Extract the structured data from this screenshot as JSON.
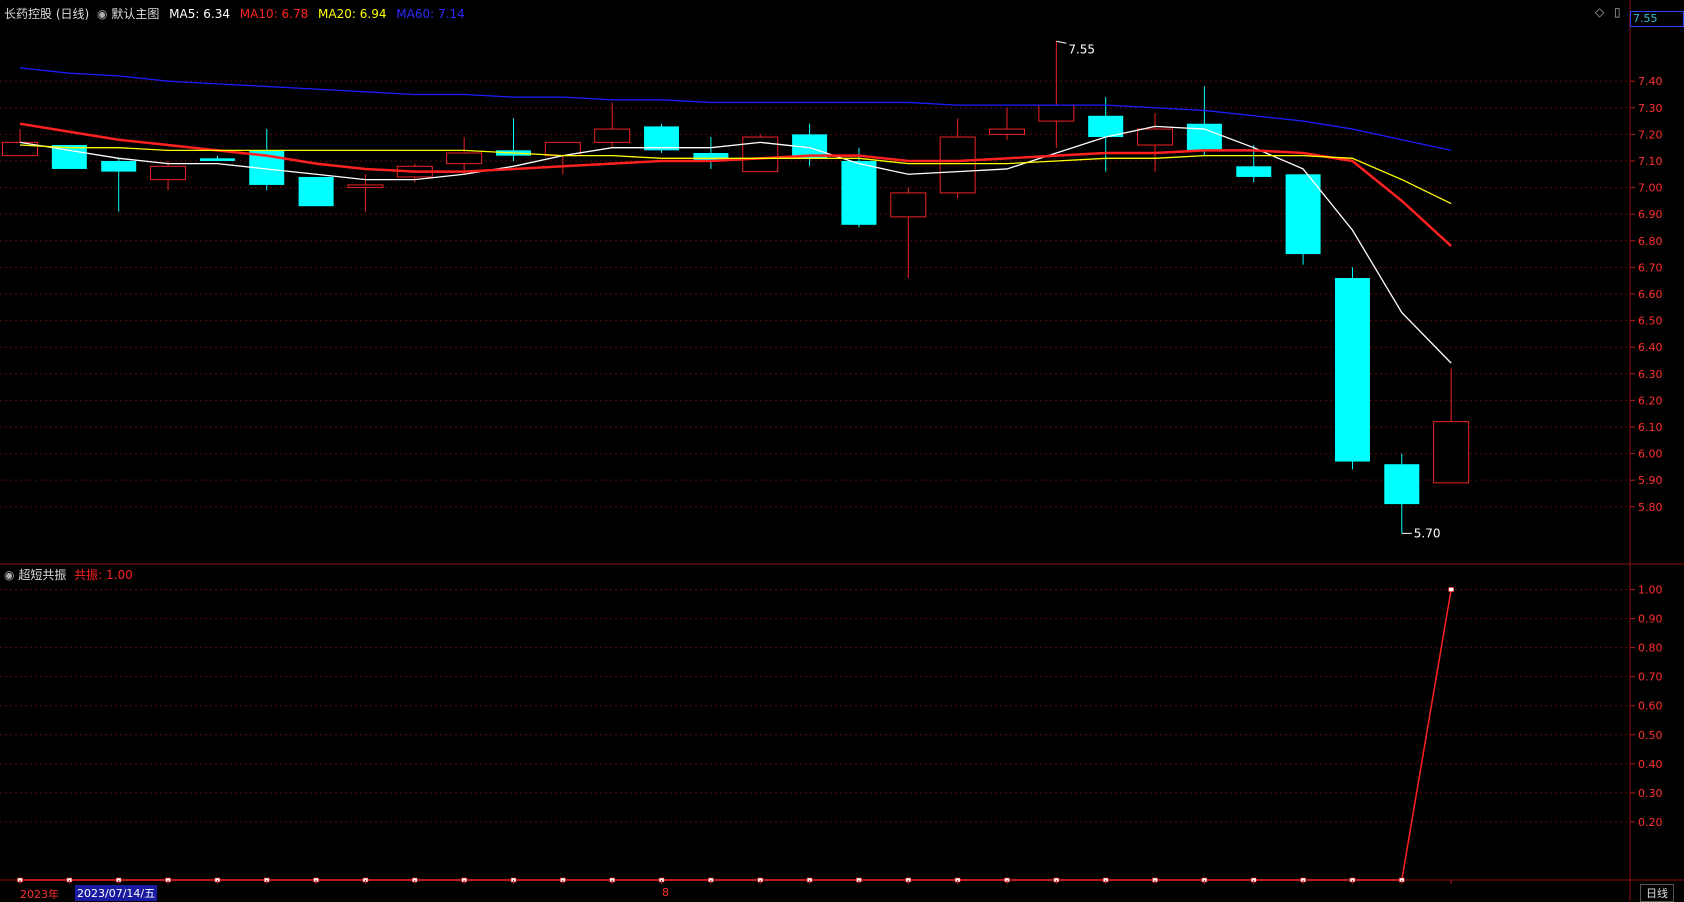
{
  "header": {
    "stock_title": "长药控股 (日线)",
    "main_chart_label": "默认主图",
    "ma5": {
      "label": "MA5:",
      "value": "6.34",
      "color": "#ffffff"
    },
    "ma10": {
      "label": "MA10:",
      "value": "6.78",
      "color": "#ff2020"
    },
    "ma20": {
      "label": "MA20:",
      "value": "6.94",
      "color": "#ffff00"
    },
    "ma60": {
      "label": "MA60:",
      "value": "7.14",
      "color": "#1c1cff"
    }
  },
  "current_price_box": "7.55",
  "high_marker": "7.55",
  "low_marker": "5.70",
  "indicator": {
    "name": "超短共振",
    "value_label": "共振:",
    "value": "1.00"
  },
  "bottom_axis": {
    "year_label": "2023年",
    "date_label": "2023/07/14/五",
    "month_label": "8",
    "period_button": "日线"
  },
  "chart_data": [
    {
      "type": "candlestick",
      "ylim": [
        5.63,
        7.63
      ],
      "y_ticks": [
        "7.40",
        "7.30",
        "7.20",
        "7.10",
        "7.00",
        "6.90",
        "6.80",
        "6.70",
        "6.60",
        "6.50",
        "6.40",
        "6.30",
        "6.20",
        "6.10",
        "6.00",
        "5.90",
        "5.80"
      ],
      "candles": [
        {
          "o": 7.12,
          "h": 7.22,
          "l": 7.12,
          "c": 7.17
        },
        {
          "o": 7.16,
          "h": 7.16,
          "l": 7.07,
          "c": 7.07
        },
        {
          "o": 7.1,
          "h": 7.11,
          "l": 6.91,
          "c": 7.06
        },
        {
          "o": 7.03,
          "h": 7.1,
          "l": 6.99,
          "c": 7.08
        },
        {
          "o": 7.11,
          "h": 7.12,
          "l": 7.1,
          "c": 7.1
        },
        {
          "o": 7.14,
          "h": 7.22,
          "l": 6.99,
          "c": 7.01
        },
        {
          "o": 7.04,
          "h": 7.04,
          "l": 6.93,
          "c": 6.93
        },
        {
          "o": 7.0,
          "h": 7.05,
          "l": 6.91,
          "c": 7.01
        },
        {
          "o": 7.04,
          "h": 7.09,
          "l": 7.02,
          "c": 7.08
        },
        {
          "o": 7.09,
          "h": 7.19,
          "l": 7.05,
          "c": 7.13
        },
        {
          "o": 7.14,
          "h": 7.26,
          "l": 7.1,
          "c": 7.12
        },
        {
          "o": 7.12,
          "h": 7.17,
          "l": 7.05,
          "c": 7.17
        },
        {
          "o": 7.17,
          "h": 7.32,
          "l": 7.15,
          "c": 7.22
        },
        {
          "o": 7.23,
          "h": 7.24,
          "l": 7.13,
          "c": 7.14
        },
        {
          "o": 7.13,
          "h": 7.19,
          "l": 7.07,
          "c": 7.1
        },
        {
          "o": 7.06,
          "h": 7.2,
          "l": 7.06,
          "c": 7.19
        },
        {
          "o": 7.2,
          "h": 7.24,
          "l": 7.08,
          "c": 7.11
        },
        {
          "o": 7.1,
          "h": 7.15,
          "l": 6.85,
          "c": 6.86
        },
        {
          "o": 6.89,
          "h": 7.0,
          "l": 6.66,
          "c": 6.98
        },
        {
          "o": 6.98,
          "h": 7.26,
          "l": 6.96,
          "c": 7.19
        },
        {
          "o": 7.2,
          "h": 7.3,
          "l": 7.18,
          "c": 7.22
        },
        {
          "o": 7.25,
          "h": 7.55,
          "l": 7.15,
          "c": 7.31
        },
        {
          "o": 7.27,
          "h": 7.34,
          "l": 7.06,
          "c": 7.19
        },
        {
          "o": 7.16,
          "h": 7.28,
          "l": 7.06,
          "c": 7.22
        },
        {
          "o": 7.24,
          "h": 7.38,
          "l": 7.12,
          "c": 7.14
        },
        {
          "o": 7.08,
          "h": 7.16,
          "l": 7.02,
          "c": 7.04
        },
        {
          "o": 7.05,
          "h": 7.05,
          "l": 6.71,
          "c": 6.75
        },
        {
          "o": 6.66,
          "h": 6.7,
          "l": 5.94,
          "c": 5.97
        },
        {
          "o": 5.96,
          "h": 6.0,
          "l": 5.7,
          "c": 5.81
        },
        {
          "o": 5.89,
          "h": 6.32,
          "l": 5.89,
          "c": 6.12
        }
      ],
      "series": [
        {
          "name": "MA5",
          "color": "#ffffff",
          "values": [
            7.17,
            7.14,
            7.11,
            7.09,
            7.09,
            7.07,
            7.05,
            7.03,
            7.03,
            7.05,
            7.08,
            7.12,
            7.15,
            7.15,
            7.15,
            7.17,
            7.15,
            7.09,
            7.05,
            7.06,
            7.07,
            7.13,
            7.19,
            7.23,
            7.22,
            7.15,
            7.07,
            6.84,
            6.53,
            6.34
          ]
        },
        {
          "name": "MA10",
          "color": "#ff2020",
          "values": [
            7.24,
            7.21,
            7.18,
            7.16,
            7.14,
            7.12,
            7.09,
            7.07,
            7.06,
            7.06,
            7.07,
            7.08,
            7.09,
            7.1,
            7.1,
            7.11,
            7.12,
            7.12,
            7.1,
            7.1,
            7.11,
            7.12,
            7.13,
            7.13,
            7.14,
            7.14,
            7.13,
            7.1,
            6.95,
            6.78
          ]
        },
        {
          "name": "MA20",
          "color": "#ffff00",
          "values": [
            7.16,
            7.15,
            7.15,
            7.14,
            7.14,
            7.14,
            7.14,
            7.14,
            7.14,
            7.14,
            7.13,
            7.12,
            7.12,
            7.11,
            7.11,
            7.11,
            7.11,
            7.11,
            7.09,
            7.09,
            7.09,
            7.1,
            7.11,
            7.11,
            7.12,
            7.12,
            7.12,
            7.11,
            7.03,
            6.94
          ]
        },
        {
          "name": "MA60",
          "color": "#1c1cff",
          "values": [
            7.45,
            7.43,
            7.42,
            7.4,
            7.39,
            7.38,
            7.37,
            7.36,
            7.35,
            7.35,
            7.34,
            7.34,
            7.33,
            7.33,
            7.32,
            7.32,
            7.32,
            7.32,
            7.32,
            7.31,
            7.31,
            7.31,
            7.31,
            7.3,
            7.29,
            7.27,
            7.25,
            7.22,
            7.18,
            7.14
          ]
        }
      ]
    },
    {
      "type": "line",
      "ylim": [
        0.0,
        1.05
      ],
      "y_ticks": [
        "1.00",
        "0.90",
        "0.80",
        "0.70",
        "0.60",
        "0.50",
        "0.40",
        "0.30",
        "0.20"
      ],
      "series": [
        {
          "name": "共振",
          "color": "#ff2020",
          "values": [
            0,
            0,
            0,
            0,
            0,
            0,
            0,
            0,
            0,
            0,
            0,
            0,
            0,
            0,
            0,
            0,
            0,
            0,
            0,
            0,
            0,
            0,
            0,
            0,
            0,
            0,
            0,
            0,
            0,
            1
          ]
        }
      ]
    }
  ]
}
